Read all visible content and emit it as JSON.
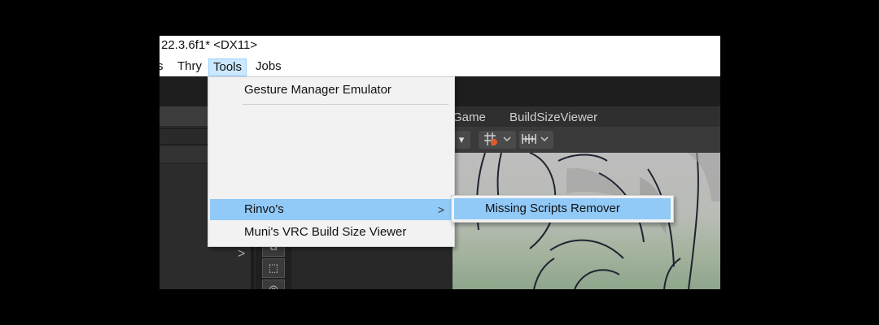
{
  "window": {
    "title": "22.3.6f1* <DX11>"
  },
  "menubar": {
    "clipped_item": "s",
    "items": [
      "Thry",
      "Tools",
      "Jobs"
    ]
  },
  "tools_menu": {
    "items": [
      {
        "label": "Gesture Manager Emulator"
      },
      {
        "label": "Rinvo's",
        "has_submenu": true,
        "highlighted": true
      },
      {
        "label": "Muni's VRC Build Size Viewer"
      }
    ],
    "submenu_arrow": ">"
  },
  "submenu": {
    "items": [
      {
        "label": "Missing Scripts Remover",
        "highlighted": true
      }
    ]
  },
  "editor": {
    "tabs": [
      "Game",
      "BuildSizeViewer"
    ],
    "left_chevron": ">"
  },
  "colors": {
    "highlight": "#91c9f7",
    "menubar_active": "#cce8ff",
    "editor_bg": "#282828"
  }
}
